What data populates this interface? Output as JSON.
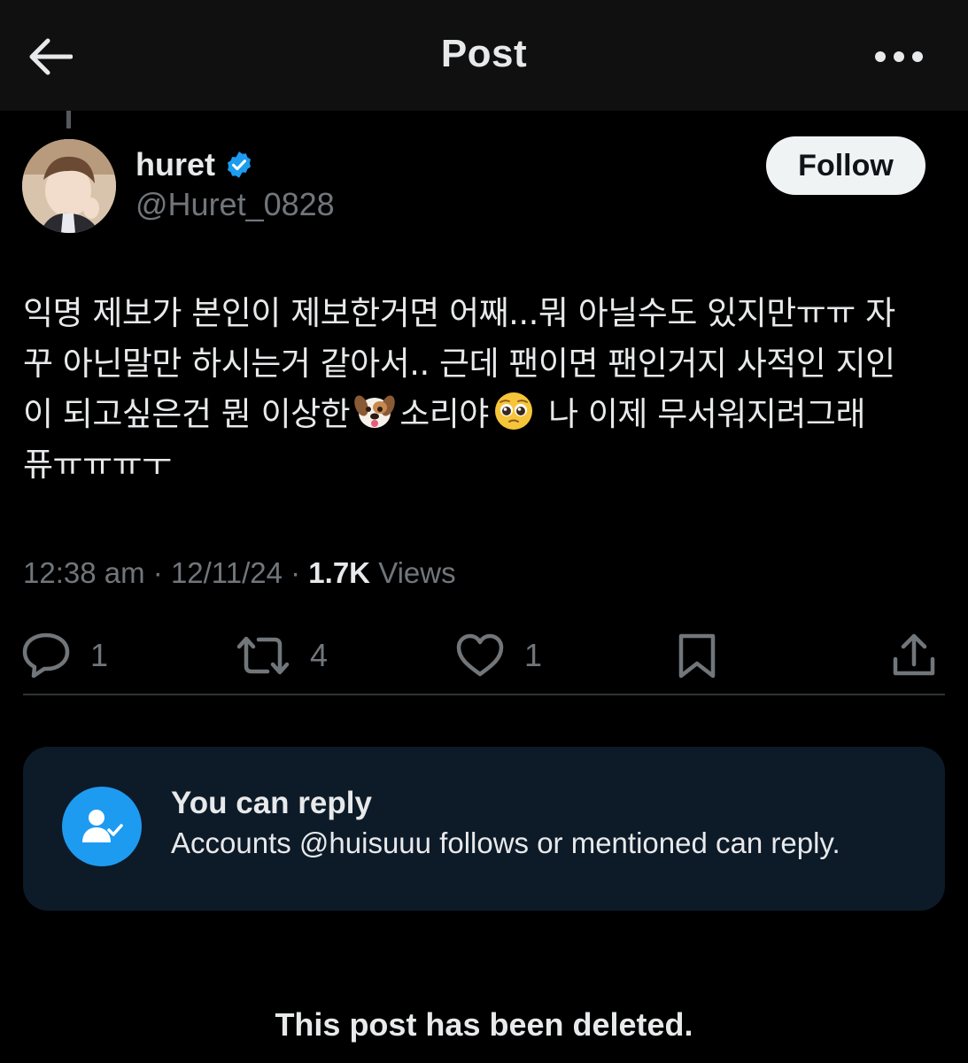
{
  "header": {
    "title": "Post",
    "back_icon": "arrow-left-icon",
    "more_icon": "more-horizontal-icon"
  },
  "author": {
    "display_name": "huret",
    "handle": "@Huret_0828",
    "verified": true,
    "verified_color": "#1d9bf0",
    "follow_label": "Follow"
  },
  "tweet": {
    "lines": [
      "익명 제보가 본인이 제보한거면 어째...뭐 아닐수도 있지만ㅠㅠ 자",
      "꾸 아닌말만 하시는거 같아서.. 근데 팬이면 팬인거지 사적인 지인",
      "이 되고싶은건 뭔 이상한",
      "소리야",
      "나 이제 무서워지려그래",
      "퓨ㅠㅠㅠㅜ"
    ],
    "emojis": [
      "dog-face-emoji",
      "pleading-face-emoji"
    ]
  },
  "meta": {
    "time": "12:38 am",
    "date": "12/11/24",
    "separator": "·",
    "views_count": "1.7K",
    "views_label": "Views"
  },
  "actions": {
    "reply_count": "1",
    "repost_count": "4",
    "like_count": "1"
  },
  "reply_restriction": {
    "title": "You can reply",
    "description": "Accounts @huisuuu follows or mentioned can reply."
  },
  "footer": {
    "notice": "This post has been deleted."
  },
  "colors": {
    "background": "#000000",
    "header_bg": "#101010",
    "text": "#e7e9ea",
    "muted": "#71767b",
    "accent": "#1d9bf0",
    "card_bg": "#0d1a28"
  }
}
